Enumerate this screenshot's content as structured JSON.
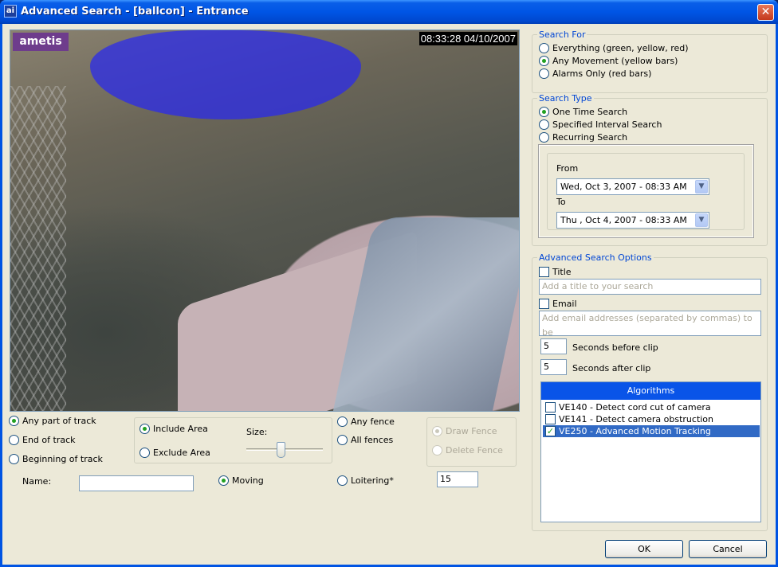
{
  "window": {
    "title": "Advanced Search - [ballcon] - Entrance",
    "app_icon": "ai"
  },
  "video": {
    "logo": "ametis",
    "timestamp": "08:33:28 04/10/2007"
  },
  "track": {
    "any_part": "Any part of track",
    "end": "End of track",
    "beginning": "Beginning of track",
    "selected": "any_part"
  },
  "area": {
    "include": "Include Area",
    "exclude": "Exclude Area",
    "size_label": "Size:",
    "selected": "include",
    "size_value": 0.45
  },
  "fence": {
    "any": "Any fence",
    "all": "All fences",
    "draw": "Draw Fence",
    "delete": "Delete Fence"
  },
  "name": {
    "label": "Name:",
    "value": ""
  },
  "motion": {
    "moving": "Moving",
    "loitering": "Loitering*",
    "loitering_value": "15",
    "selected": "moving"
  },
  "search_for": {
    "legend": "Search For",
    "options": [
      "Everything (green, yellow, red)",
      "Any Movement (yellow bars)",
      "Alarms Only (red bars)"
    ],
    "selected": 1
  },
  "search_type": {
    "legend": "Search Type",
    "options": [
      "One Time Search",
      "Specified Interval Search",
      "Recurring Search"
    ],
    "selected": 0,
    "from_label": "From",
    "from_value": "Wed, Oct   3, 2007 - 08:33 AM",
    "to_label": "To",
    "to_value": "Thu , Oct   4, 2007 - 08:33 AM"
  },
  "options": {
    "legend": "Advanced Search Options",
    "title_label": "Title",
    "title_placeholder": "Add a title to your search",
    "email_label": "Email",
    "email_placeholder": "Add email addresses (separated by commas) to be",
    "before_value": "5",
    "before_label": "Seconds before clip",
    "after_value": "5",
    "after_label": "Seconds after clip"
  },
  "algorithms": {
    "header": "Algorithms",
    "items": [
      {
        "label": "VE140 - Detect cord cut of camera",
        "checked": false
      },
      {
        "label": "VE141 - Detect camera obstruction",
        "checked": false
      },
      {
        "label": "VE250 - Advanced Motion Tracking",
        "checked": true
      }
    ]
  },
  "buttons": {
    "ok": "OK",
    "cancel": "Cancel"
  },
  "colors": {
    "accent": "#0054e3",
    "radio_dot": "#21a121",
    "mask": "#2828f0"
  }
}
